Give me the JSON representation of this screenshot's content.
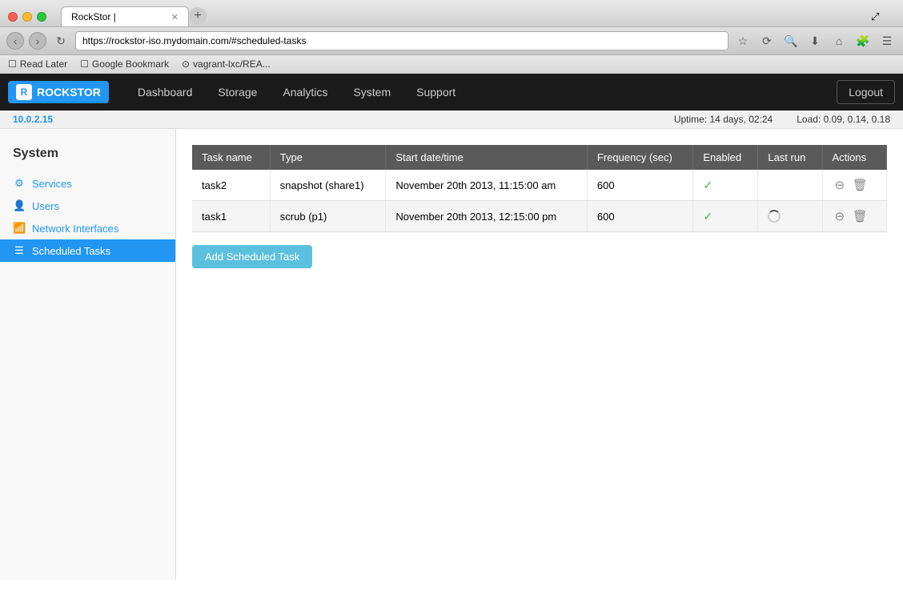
{
  "browser": {
    "title": "RockStor |",
    "tab_title": "RockStor |",
    "url": "https://rockstor-iso.mydomain.com/#scheduled-tasks",
    "new_tab_tooltip": "New Tab",
    "bookmarks": [
      {
        "label": "Read Later"
      },
      {
        "label": "Google Bookmark"
      },
      {
        "label": "vagrant-lxc/REA..."
      }
    ]
  },
  "app": {
    "logo": "ROCKSTOR",
    "nav_items": [
      {
        "label": "Dashboard"
      },
      {
        "label": "Storage"
      },
      {
        "label": "Analytics"
      },
      {
        "label": "System"
      },
      {
        "label": "Support"
      }
    ],
    "logout_label": "Logout"
  },
  "status_bar": {
    "version": "10.0.2.15",
    "uptime_label": "Uptime: 14 days, 02:24",
    "load_label": "Load: 0.09, 0.14, 0.18"
  },
  "sidebar": {
    "section_title": "System",
    "items": [
      {
        "label": "Services",
        "icon": "⚙",
        "id": "services"
      },
      {
        "label": "Users",
        "icon": "👤",
        "id": "users"
      },
      {
        "label": "Network Interfaces",
        "icon": "📶",
        "id": "network"
      },
      {
        "label": "Scheduled Tasks",
        "icon": "☰",
        "id": "scheduled-tasks",
        "active": true
      }
    ]
  },
  "content": {
    "table": {
      "columns": [
        {
          "label": "Task name"
        },
        {
          "label": "Type"
        },
        {
          "label": "Start date/time"
        },
        {
          "label": "Frequency (sec)"
        },
        {
          "label": "Enabled"
        },
        {
          "label": "Last run"
        },
        {
          "label": "Actions"
        }
      ],
      "rows": [
        {
          "task_name": "task2",
          "type": "snapshot (share1)",
          "start_datetime": "November 20th 2013, 11:15:00 am",
          "frequency": "600",
          "enabled": true,
          "last_run": "",
          "spinning": false
        },
        {
          "task_name": "task1",
          "type": "scrub (p1)",
          "start_datetime": "November 20th 2013, 12:15:00 pm",
          "frequency": "600",
          "enabled": true,
          "last_run": "",
          "spinning": true
        }
      ]
    },
    "add_button_label": "Add Scheduled Task"
  }
}
